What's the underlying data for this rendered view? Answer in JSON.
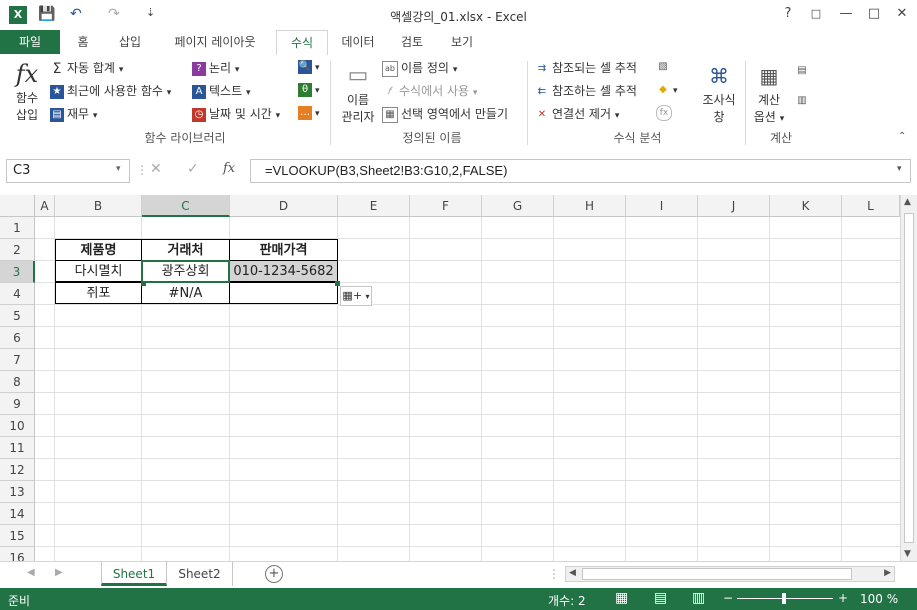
{
  "window": {
    "title": "액셀강의_01.xlsx - Excel",
    "help": "?",
    "restore": "□",
    "minimize": "—",
    "maximize": "□",
    "close": "✕"
  },
  "qat": {
    "save": "💾",
    "undo": "↶",
    "redo": "↷",
    "customize": "⇣"
  },
  "tabs": [
    "파일",
    "홈",
    "삽입",
    "페이지 레이아웃",
    "수식",
    "데이터",
    "검토",
    "보기"
  ],
  "active_tab": "수식",
  "ribbon": {
    "insert_function": {
      "glyph": "fx",
      "label1": "함수",
      "label2": "삽입"
    },
    "library": {
      "autosum": "자동 합계",
      "recent": "최근에 사용한 함수",
      "financial": "재무",
      "logical": "논리",
      "text": "텍스트",
      "datetime": "날짜 및 시간",
      "group_label": "함수 라이브러리"
    },
    "names": {
      "manager1": "이름",
      "manager2": "관리자",
      "define": "이름 정의",
      "use_in_formula": "수식에서 사용",
      "create_from_selection": "선택 영역에서 만들기",
      "group_label": "정의된 이름"
    },
    "auditing": {
      "trace_precedents": "참조되는 셀 추적",
      "trace_dependents": "참조하는 셀 추적",
      "remove_arrows": "연결선 제거",
      "watch1": "조사식",
      "watch2": "창",
      "group_label": "수식 분석"
    },
    "calculation": {
      "options1": "계산",
      "options2": "옵션",
      "group_label": "계산"
    }
  },
  "formula_bar": {
    "name_box": "C3",
    "cancel": "✕",
    "enter": "✓",
    "fx": "fx",
    "formula": "=VLOOKUP(B3,Sheet2!B3:G10,2,FALSE)"
  },
  "columns": [
    "A",
    "B",
    "C",
    "D",
    "E",
    "F",
    "G",
    "H",
    "I",
    "J",
    "K",
    "L"
  ],
  "rows": [
    "1",
    "2",
    "3",
    "4",
    "5",
    "6",
    "7",
    "8",
    "9",
    "10",
    "11",
    "12",
    "13",
    "14",
    "15",
    "16"
  ],
  "table": {
    "headers": [
      "제품명",
      "거래처",
      "판매가격"
    ],
    "row1": [
      "다시멸치",
      "광주상회",
      "010-1234-5682"
    ],
    "row2": [
      "쥐포",
      "#N/A",
      ""
    ]
  },
  "sheets": [
    "Sheet1",
    "Sheet2"
  ],
  "active_sheet": "Sheet1",
  "status": {
    "mode": "준비",
    "count": "개수: 2",
    "zoom": "100 %",
    "zoom_minus": "−",
    "zoom_plus": "+"
  },
  "colors": {
    "accent": "#217346",
    "selected_cell": "#d3d3d3"
  }
}
